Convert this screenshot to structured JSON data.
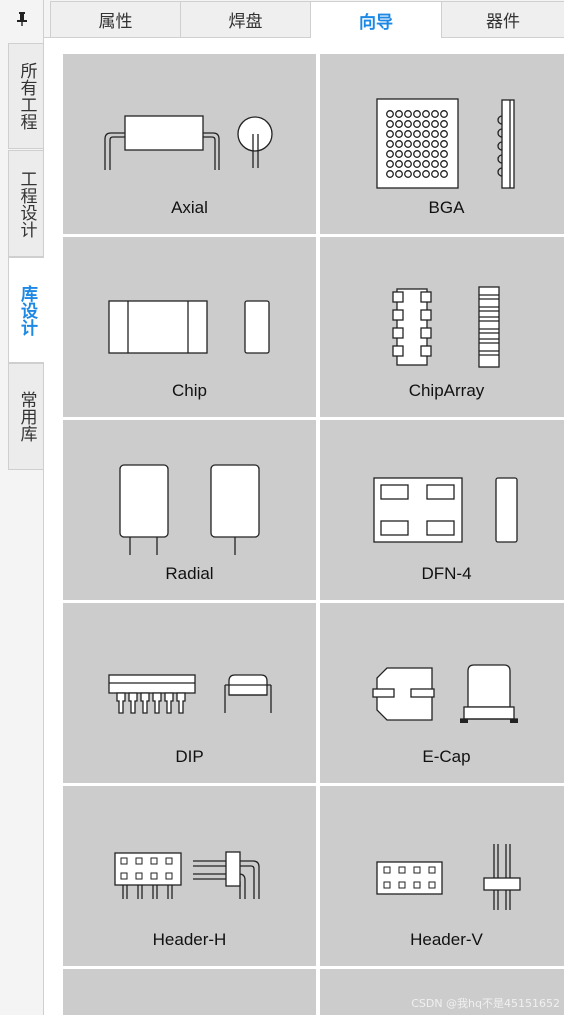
{
  "rail": {
    "pin_icon": "pin-icon",
    "tabs": [
      {
        "label": "所有工程",
        "active": false
      },
      {
        "label": "工程设计",
        "active": false
      },
      {
        "label": "库设计",
        "active": true
      },
      {
        "label": "常用库",
        "active": false
      }
    ]
  },
  "top_tabs": [
    {
      "label": "属性",
      "active": false
    },
    {
      "label": "焊盘",
      "active": false
    },
    {
      "label": "向导",
      "active": true
    },
    {
      "label": "器件",
      "active": false
    }
  ],
  "colors": {
    "accent": "#1e88e5",
    "tile_bg": "#cccccc"
  },
  "wizards": [
    {
      "label": "Axial",
      "icon": "axial-icon"
    },
    {
      "label": "BGA",
      "icon": "bga-icon"
    },
    {
      "label": "Chip",
      "icon": "chip-icon"
    },
    {
      "label": "ChipArray",
      "icon": "chiparray-icon"
    },
    {
      "label": "Radial",
      "icon": "radial-icon"
    },
    {
      "label": "DFN-4",
      "icon": "dfn4-icon"
    },
    {
      "label": "DIP",
      "icon": "dip-icon"
    },
    {
      "label": "E-Cap",
      "icon": "ecap-icon"
    },
    {
      "label": "Header-H",
      "icon": "header-h-icon"
    },
    {
      "label": "Header-V",
      "icon": "header-v-icon"
    }
  ],
  "watermark": "CSDN @我hq不是45151652"
}
